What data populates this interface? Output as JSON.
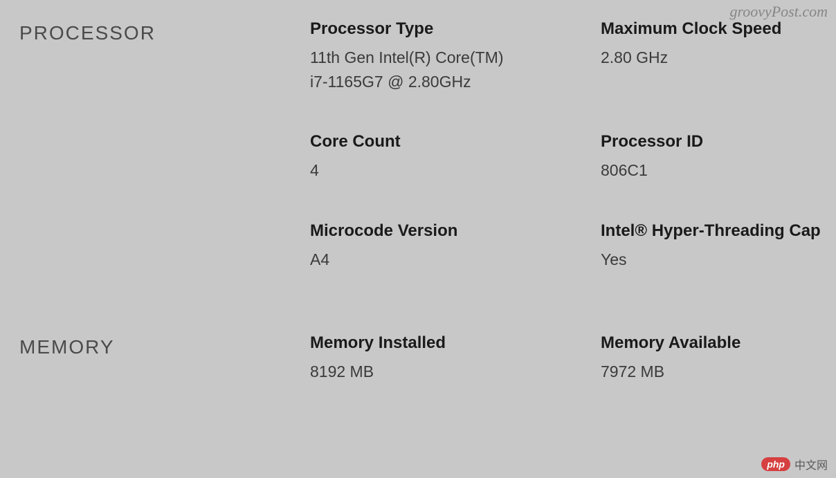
{
  "watermarks": {
    "top_right": "groovyPost.com",
    "bottom_right_badge": "php",
    "bottom_right_text": "中文网"
  },
  "sections": {
    "processor": {
      "header": "PROCESSOR",
      "fields": {
        "processor_type": {
          "label": "Processor Type",
          "value": "11th Gen Intel(R) Core(TM)\ni7-1165G7 @ 2.80GHz"
        },
        "max_clock_speed": {
          "label": "Maximum Clock Speed",
          "value": "2.80 GHz"
        },
        "core_count": {
          "label": "Core Count",
          "value": "4"
        },
        "processor_id": {
          "label": "Processor ID",
          "value": "806C1"
        },
        "microcode_version": {
          "label": "Microcode Version",
          "value": "A4"
        },
        "hyper_threading": {
          "label": "Intel® Hyper-Threading Cap",
          "value": "Yes"
        }
      }
    },
    "memory": {
      "header": "MEMORY",
      "fields": {
        "memory_installed": {
          "label": "Memory Installed",
          "value": "8192 MB"
        },
        "memory_available": {
          "label": "Memory Available",
          "value": "7972 MB"
        }
      }
    }
  }
}
